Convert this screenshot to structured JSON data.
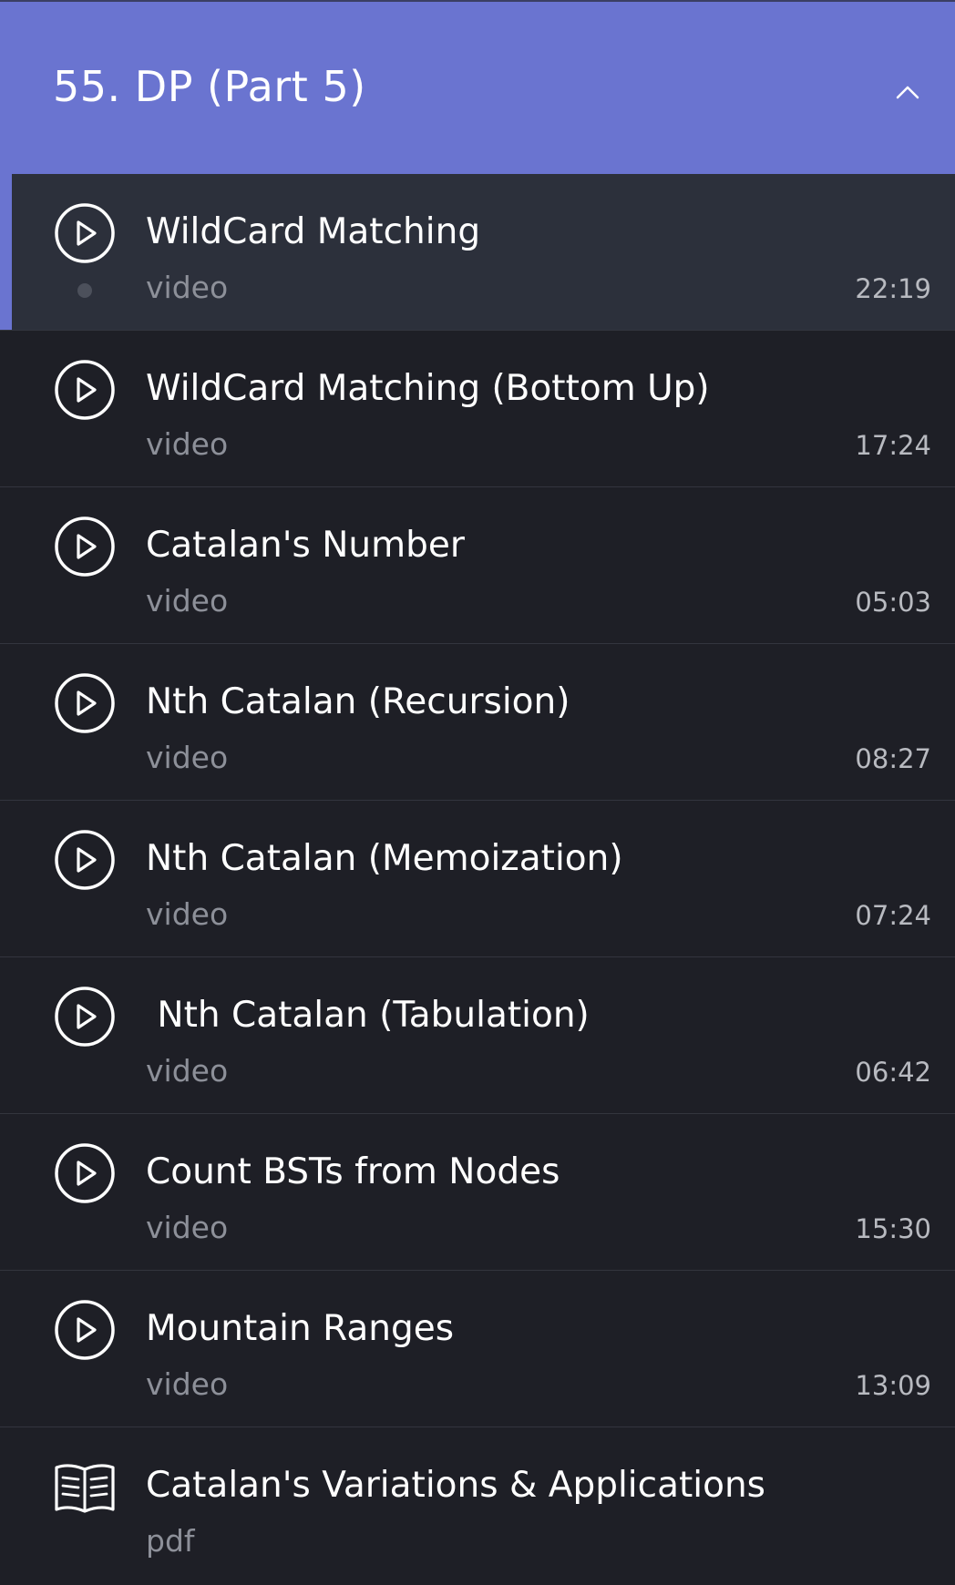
{
  "section": {
    "title": "55. DP (Part 5)",
    "toggle_icon": "chevron-up-icon",
    "accent_color": "#6a74d0"
  },
  "lessons": [
    {
      "title": "WildCard Matching",
      "type": "video",
      "duration": "22:19",
      "icon": "play-circle-icon",
      "active": true
    },
    {
      "title": "WildCard Matching (Bottom Up)",
      "type": "video",
      "duration": "17:24",
      "icon": "play-circle-icon"
    },
    {
      "title": "Catalan's Number",
      "type": "video",
      "duration": "05:03",
      "icon": "play-circle-icon"
    },
    {
      "title": "Nth Catalan (Recursion)",
      "type": "video",
      "duration": "08:27",
      "icon": "play-circle-icon"
    },
    {
      "title": "Nth Catalan (Memoization)",
      "type": "video",
      "duration": "07:24",
      "icon": "play-circle-icon"
    },
    {
      "title": " Nth Catalan (Tabulation)",
      "type": "video",
      "duration": "06:42",
      "icon": "play-circle-icon"
    },
    {
      "title": "Count BSTs from Nodes",
      "type": "video",
      "duration": "15:30",
      "icon": "play-circle-icon"
    },
    {
      "title": "Mountain Ranges",
      "type": "video",
      "duration": "13:09",
      "icon": "play-circle-icon"
    },
    {
      "title": "Catalan's Variations & Applications",
      "type": "pdf",
      "duration": "",
      "icon": "open-book-icon"
    }
  ]
}
